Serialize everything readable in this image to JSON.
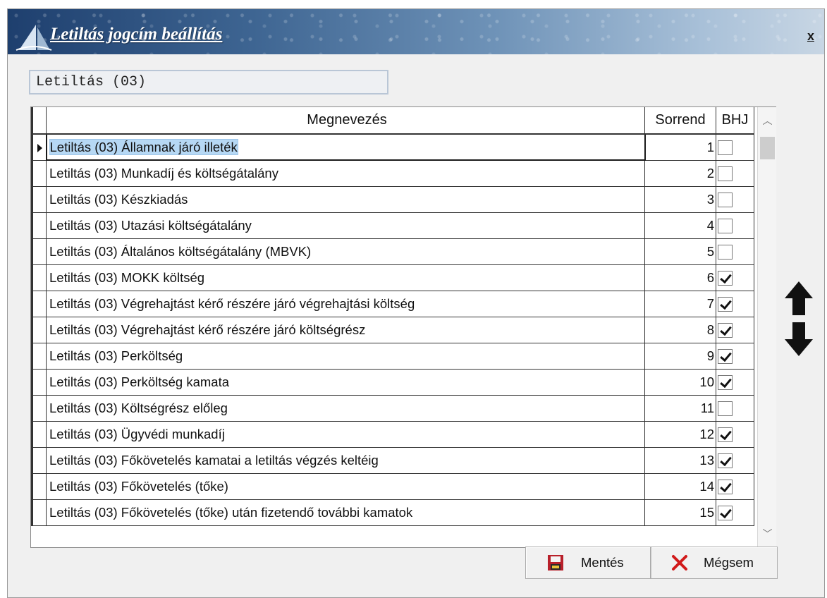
{
  "window": {
    "title": "Letiltás jogcím beállítás",
    "close_label": "x"
  },
  "name_field": {
    "value": "Letiltás (03)"
  },
  "grid": {
    "columns": {
      "name": "Megnevezés",
      "order": "Sorrend",
      "bhj": "BHJ"
    },
    "rows": [
      {
        "name": "Letiltás (03) Államnak járó illeték",
        "order": "1",
        "bhj": false,
        "selected": true
      },
      {
        "name": "Letiltás (03) Munkadíj és költségátalány",
        "order": "2",
        "bhj": false
      },
      {
        "name": "Letiltás (03) Készkiadás",
        "order": "3",
        "bhj": false
      },
      {
        "name": "Letiltás (03) Utazási költségátalány",
        "order": "4",
        "bhj": false
      },
      {
        "name": "Letiltás (03) Általános költségátalány (MBVK)",
        "order": "5",
        "bhj": false
      },
      {
        "name": "Letiltás (03) MOKK költség",
        "order": "6",
        "bhj": true
      },
      {
        "name": "Letiltás (03) Végrehajtást kérő részére járó végrehajtási költség",
        "order": "7",
        "bhj": true
      },
      {
        "name": "Letiltás (03) Végrehajtást kérő részére járó költségrész",
        "order": "8",
        "bhj": true
      },
      {
        "name": "Letiltás (03) Perköltség",
        "order": "9",
        "bhj": true
      },
      {
        "name": "Letiltás (03) Perköltség kamata",
        "order": "10",
        "bhj": true
      },
      {
        "name": "Letiltás (03) Költségrész előleg",
        "order": "11",
        "bhj": false
      },
      {
        "name": "Letiltás (03) Ügyvédi munkadíj",
        "order": "12",
        "bhj": true
      },
      {
        "name": "Letiltás (03) Főkövetelés kamatai a letiltás végzés keltéig",
        "order": "13",
        "bhj": true
      },
      {
        "name": "Letiltás (03) Főkövetelés (tőke)",
        "order": "14",
        "bhj": true
      },
      {
        "name": "Letiltás (03) Főkövetelés (tőke) után fizetendő további kamatok",
        "order": "15",
        "bhj": true
      }
    ]
  },
  "buttons": {
    "save_label": "Mentés",
    "cancel_label": "Mégsem"
  },
  "icons": {
    "logo": "sail-logo-icon",
    "save": "floppy-disk-icon",
    "cancel": "red-x-icon",
    "move_up": "arrow-up-icon",
    "move_down": "arrow-down-icon"
  },
  "colors": {
    "titlebar": "#3e6592",
    "selection": "#b6d8f4",
    "cancel_icon": "#d11a1a",
    "save_icon": "#b8202a"
  }
}
